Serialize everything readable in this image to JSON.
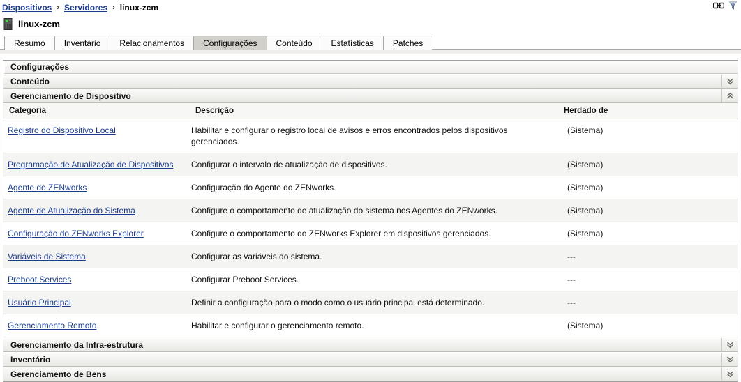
{
  "breadcrumb": {
    "items": [
      {
        "label": "Dispositivos",
        "link": true
      },
      {
        "label": "Servidores",
        "link": true
      },
      {
        "label": "linux-zcm",
        "link": false
      }
    ],
    "separator": "›",
    "tools": [
      {
        "name": "link-icon",
        "title": "Link"
      },
      {
        "name": "funnel-icon",
        "title": "Filtro"
      }
    ]
  },
  "page": {
    "title": "linux-zcm",
    "icon": "server-icon"
  },
  "tabs": [
    {
      "label": "Resumo",
      "active": false
    },
    {
      "label": "Inventário",
      "active": false
    },
    {
      "label": "Relacionamentos",
      "active": false
    },
    {
      "label": "Configurações",
      "active": true
    },
    {
      "label": "Conteúdo",
      "active": false
    },
    {
      "label": "Estatísticas",
      "active": false
    },
    {
      "label": "Patches",
      "active": false
    }
  ],
  "panel": {
    "title": "Configurações"
  },
  "sections": [
    {
      "label": "Conteúdo",
      "expanded": false,
      "chevron": "chevron-double-down-icon"
    },
    {
      "label": "Gerenciamento de Dispositivo",
      "expanded": true,
      "chevron": "chevron-double-up-icon"
    },
    {
      "label": "Gerenciamento da Infra-estrutura",
      "expanded": false,
      "chevron": "chevron-double-down-icon"
    },
    {
      "label": "Inventário",
      "expanded": false,
      "chevron": "chevron-double-down-icon"
    },
    {
      "label": "Gerenciamento de Bens",
      "expanded": false,
      "chevron": "chevron-double-down-icon"
    }
  ],
  "table": {
    "columns": [
      "Categoria",
      "Descrição",
      "Herdado de"
    ],
    "rows": [
      {
        "categoria": "Registro do Dispositivo Local",
        "descricao": "Habilitar e configurar o registro local de avisos e erros encontrados pelos dispositivos gerenciados.",
        "herdado": "(Sistema)"
      },
      {
        "categoria": "Programação de Atualização de Dispositivos",
        "descricao": "Configurar o intervalo de atualização de dispositivos.",
        "herdado": "(Sistema)"
      },
      {
        "categoria": "Agente do ZENworks",
        "descricao": "Configuração do Agente do ZENworks.",
        "herdado": "(Sistema)"
      },
      {
        "categoria": "Agente de Atualização do Sistema",
        "descricao": "Configure o comportamento de atualização do sistema nos Agentes do ZENworks.",
        "herdado": "(Sistema)"
      },
      {
        "categoria": "Configuração do ZENworks Explorer",
        "descricao": "Configure o comportamento do ZENworks Explorer em dispositivos gerenciados.",
        "herdado": "(Sistema)"
      },
      {
        "categoria": "Variáveis de Sistema",
        "descricao": "Configurar as variáveis do sistema.",
        "herdado": "---"
      },
      {
        "categoria": "Preboot Services",
        "descricao": "Configurar Preboot Services.",
        "herdado": "---"
      },
      {
        "categoria": "Usuário Principal",
        "descricao": "Definir a configuração para o modo como o usuário principal está determinado.",
        "herdado": "---"
      },
      {
        "categoria": "Gerenciamento Remoto",
        "descricao": "Habilitar e configurar o gerenciamento remoto.",
        "herdado": "(Sistema)"
      }
    ]
  },
  "colors": {
    "link": "#1a3c8c",
    "section_bg": "#e8e7e4",
    "active_tab_bg": "#d2d0cb",
    "row_alt_bg": "#f4f4f2",
    "border": "#9e9e9e"
  }
}
